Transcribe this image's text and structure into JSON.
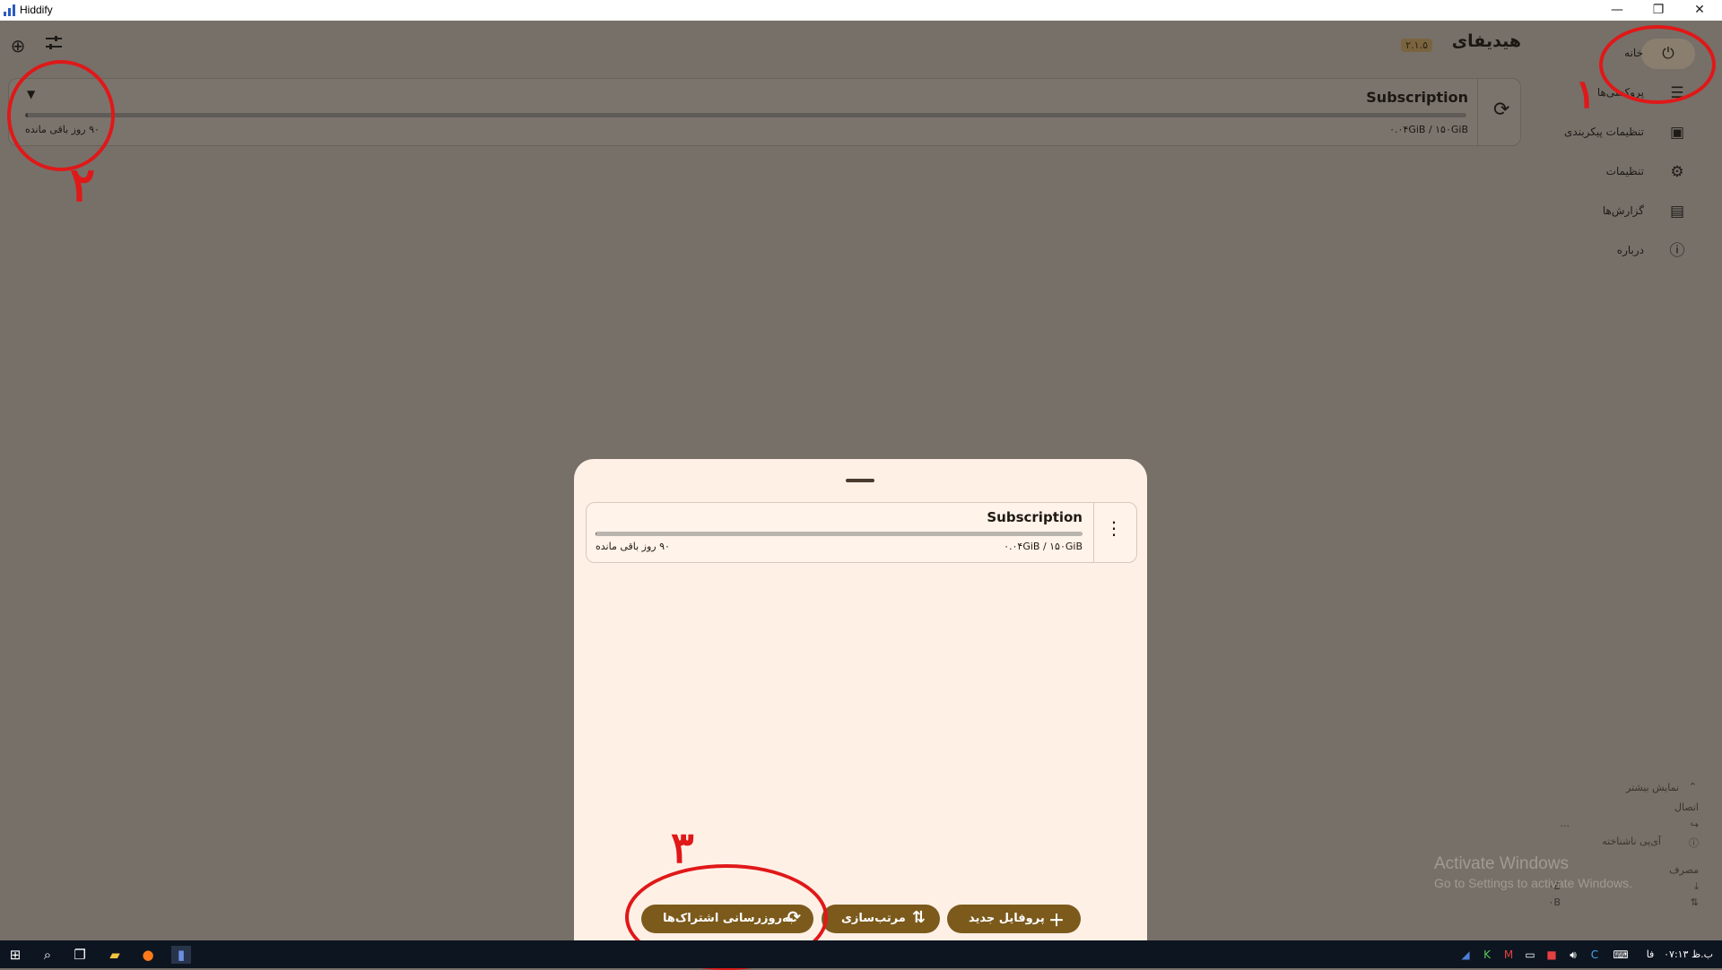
{
  "window": {
    "title": "Hiddify",
    "controls": {
      "minimize": "—",
      "restore": "❐",
      "close": "✕"
    }
  },
  "header": {
    "app_title": "هیدیفای",
    "version": "۲.۱.۵",
    "add_icon": "add-circle-icon",
    "filter_icon": "tune-icon"
  },
  "subscription": {
    "name": "Subscription",
    "usage": "۰.۰۴GiB / ۱۵۰GiB",
    "remaining": "۹۰ روز باقی مانده",
    "progress": 0.0003
  },
  "sidebar": {
    "items": [
      {
        "label": "خانه",
        "icon": "power-icon",
        "active": true
      },
      {
        "label": "پروکسی‌ها",
        "icon": "filter-list-icon"
      },
      {
        "label": "تنظیمات پیکربندی",
        "icon": "package-icon"
      },
      {
        "label": "تنظیمات",
        "icon": "gear-icon"
      },
      {
        "label": "گزارش‌ها",
        "icon": "document-icon"
      },
      {
        "label": "درباره",
        "icon": "info-icon"
      }
    ]
  },
  "stats": {
    "show_more": "نمایش بیشتر",
    "connection_header": "اتصال",
    "ellipsis": "...",
    "unknown_ip": "آی‌پی ناشناخته",
    "usage_header": "مصرف",
    "download_value": "۰B",
    "upload_value": "۰B"
  },
  "annotations": {
    "one": "۱",
    "two": "۲",
    "three": "۳"
  },
  "sheet": {
    "card": {
      "name": "Subscription",
      "usage": "۰.۰۴GiB / ۱۵۰GiB",
      "remaining": "۹۰ روز باقی مانده",
      "progress": 0.0003
    },
    "buttons": {
      "new_profile": "پروفایل جدید",
      "sort": "مرتب‌سازی",
      "update_subs": "به‌روزرسانی اشتراک‌ها"
    }
  },
  "watermark": {
    "line1": "Activate Windows",
    "line2": "Go to Settings to activate Windows."
  },
  "taskbar": {
    "language": "فا",
    "clock": "ب.ظ ۰۷:۱۳"
  },
  "colors": {
    "accent": "#7b5a1c",
    "annotation": "#e01818",
    "sheet_bg": "#fff0e6",
    "scrim_bg": "#767069"
  }
}
